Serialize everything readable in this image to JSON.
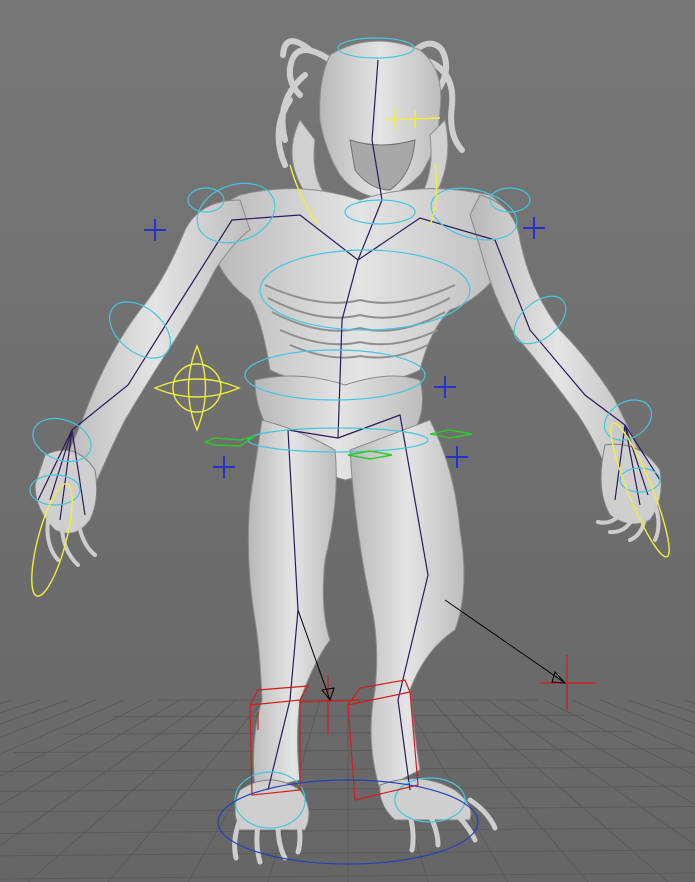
{
  "viewport": {
    "view": "perspective",
    "background_color": "#6e6e6e",
    "grid_color": "#5a5a5a"
  },
  "model": {
    "subject": "creature-sculpt",
    "mesh_color": "#d6d6d6",
    "mesh_shadow": "#9a9a9a"
  },
  "rig": {
    "joint_line_color": "#2e1a5e",
    "fk_control_color": "#45c6e0",
    "highlight_control_color": "#f2ee3a",
    "hip_control_color": "#2ccb2c",
    "ik_handle_color": "#d41c1c",
    "locator_color": "#2533c8",
    "pole_vector_color": "#000000",
    "root_control_color": "#2541b8"
  }
}
